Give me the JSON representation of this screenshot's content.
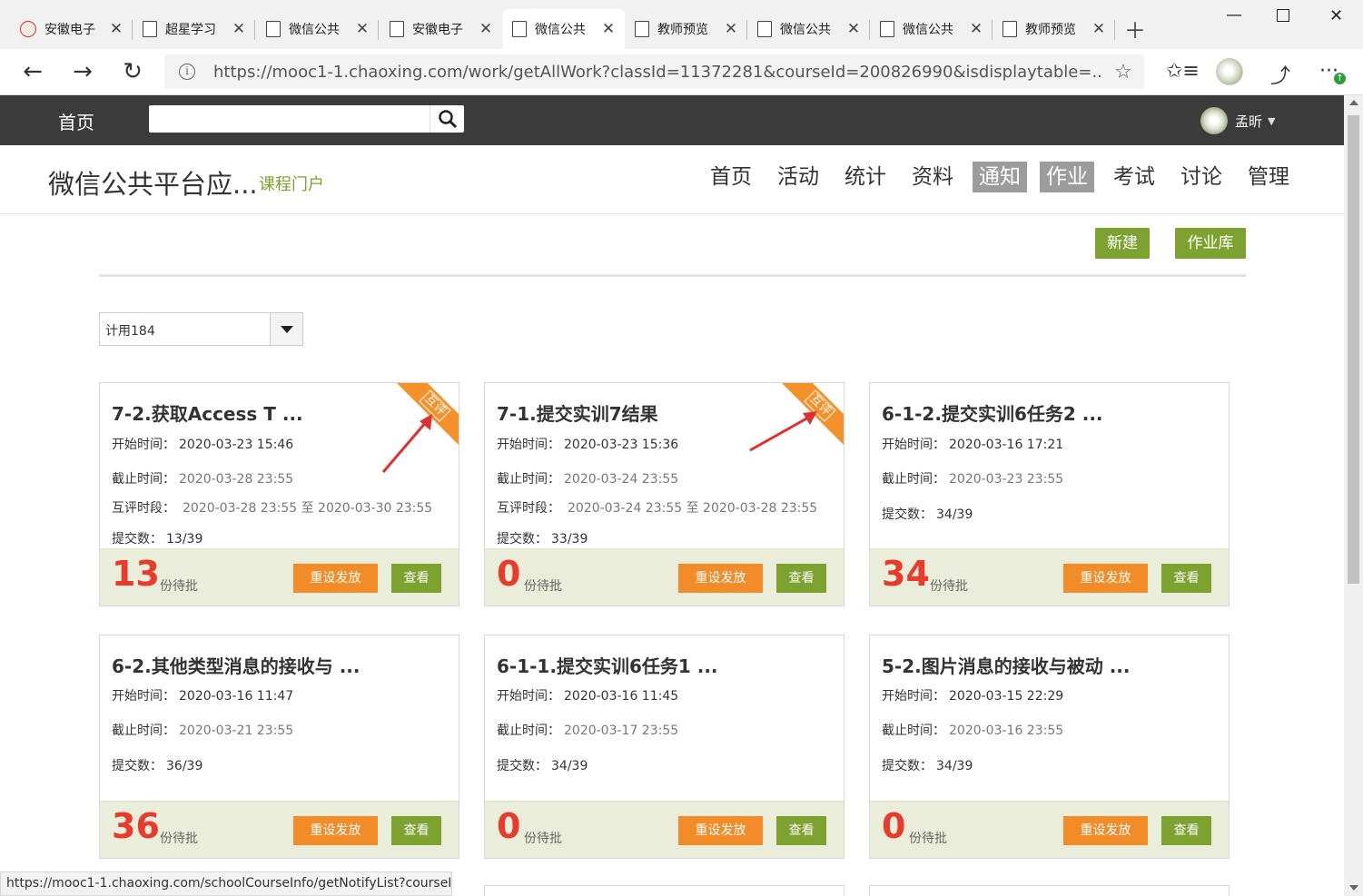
{
  "browser": {
    "tabs": [
      {
        "title": "安徽电子",
        "icon": "school-seal-icon"
      },
      {
        "title": "超星学习",
        "icon": "page-icon"
      },
      {
        "title": "微信公共",
        "icon": "page-icon"
      },
      {
        "title": "安徽电子",
        "icon": "page-icon"
      },
      {
        "title": "微信公共",
        "icon": "page-icon",
        "active": true
      },
      {
        "title": "教师预览",
        "icon": "page-icon"
      },
      {
        "title": "微信公共",
        "icon": "page-icon"
      },
      {
        "title": "微信公共",
        "icon": "page-icon"
      },
      {
        "title": "教师预览",
        "icon": "page-icon"
      }
    ],
    "url": "https://mooc1-1.chaoxing.com/work/getAllWork?classId=11372281&courseId=200826990&isdisplaytable=...",
    "status_url": "https://mooc1-1.chaoxing.com/schoolCourseInfo/getNotifyList?courseI..."
  },
  "site": {
    "home": "首页",
    "search_placeholder": "",
    "user_name": "孟昕"
  },
  "course": {
    "title": "微信公共平台应...",
    "portal": "课程门户",
    "nav": [
      "首页",
      "活动",
      "统计",
      "资料",
      "通知",
      "作业",
      "考试",
      "讨论",
      "管理"
    ],
    "highlighted_nav": [
      "通知",
      "作业"
    ]
  },
  "actions": {
    "new": "新建",
    "library": "作业库"
  },
  "class_select": "计用184",
  "labels": {
    "start": "开始时间：",
    "end": "截止时间：",
    "peer": "互评时段：",
    "submit": "提交数：",
    "pending": "份待批",
    "reset": "重设发放",
    "view": "查看",
    "peer_badge": "互评"
  },
  "cards": [
    {
      "title": "7-2.获取Access T ...",
      "start": "2020-03-23 15:46",
      "end": "2020-03-28 23:55",
      "peer": "2020-03-28 23:55 至 2020-03-30 23:55",
      "submit": "13/39",
      "pending": "13",
      "badge": true
    },
    {
      "title": "7-1.提交实训7结果",
      "start": "2020-03-23 15:36",
      "end": "2020-03-24 23:55",
      "peer": "2020-03-24 23:55 至 2020-03-28 23:55",
      "submit": "33/39",
      "pending": "0",
      "badge": true
    },
    {
      "title": "6-1-2.提交实训6任务2 ...",
      "start": "2020-03-16 17:21",
      "end": "2020-03-23 23:55",
      "submit": "34/39",
      "pending": "34",
      "badge": false
    },
    {
      "title": "6-2.其他类型消息的接收与 ...",
      "start": "2020-03-16 11:47",
      "end": "2020-03-21 23:55",
      "submit": "36/39",
      "pending": "36",
      "badge": false
    },
    {
      "title": "6-1-1.提交实训6任务1 ...",
      "start": "2020-03-16 11:45",
      "end": "2020-03-17 23:55",
      "submit": "34/39",
      "pending": "0",
      "badge": false
    },
    {
      "title": "5-2.图片消息的接收与被动 ...",
      "start": "2020-03-15 22:29",
      "end": "2020-03-16 23:55",
      "submit": "34/39",
      "pending": "0",
      "badge": false
    }
  ],
  "colors": {
    "accent_green": "#7da230",
    "orange": "#f28c28",
    "pending_red": "#e93b2c",
    "header_dark": "#3b3b3b",
    "annotation_arrow": "#e03030"
  }
}
